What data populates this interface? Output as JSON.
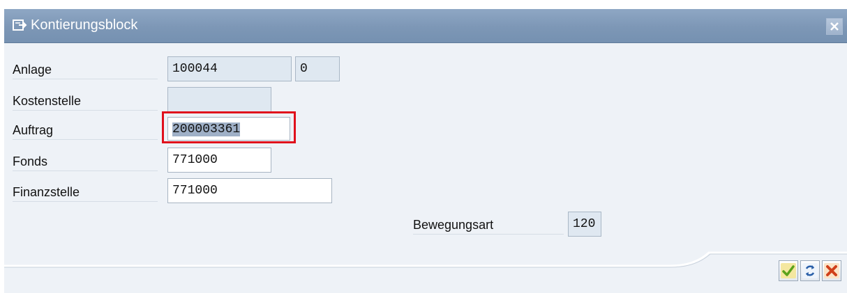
{
  "window": {
    "title": "Kontierungsblock"
  },
  "fields": {
    "anlage": {
      "label": "Anlage",
      "value": "100044",
      "sub_value": "0"
    },
    "kostenstelle": {
      "label": "Kostenstelle",
      "value": ""
    },
    "auftrag": {
      "label": "Auftrag",
      "value": "200003361"
    },
    "fonds": {
      "label": "Fonds",
      "value": "771000"
    },
    "finanzstelle": {
      "label": "Finanzstelle",
      "value": "771000"
    },
    "bewegungsart": {
      "label": "Bewegungsart",
      "value": "120"
    }
  },
  "toolbar": {
    "buttons": [
      {
        "icon": "checkmark-icon",
        "color": "#5aa21c"
      },
      {
        "icon": "refresh-icon",
        "color": "#2a5fa8"
      },
      {
        "icon": "cancel-icon",
        "color": "#d0401a"
      }
    ]
  },
  "colors": {
    "title_bar": "#7d97b6",
    "highlight_border": "#e0101c",
    "background": "#eef2f7"
  }
}
